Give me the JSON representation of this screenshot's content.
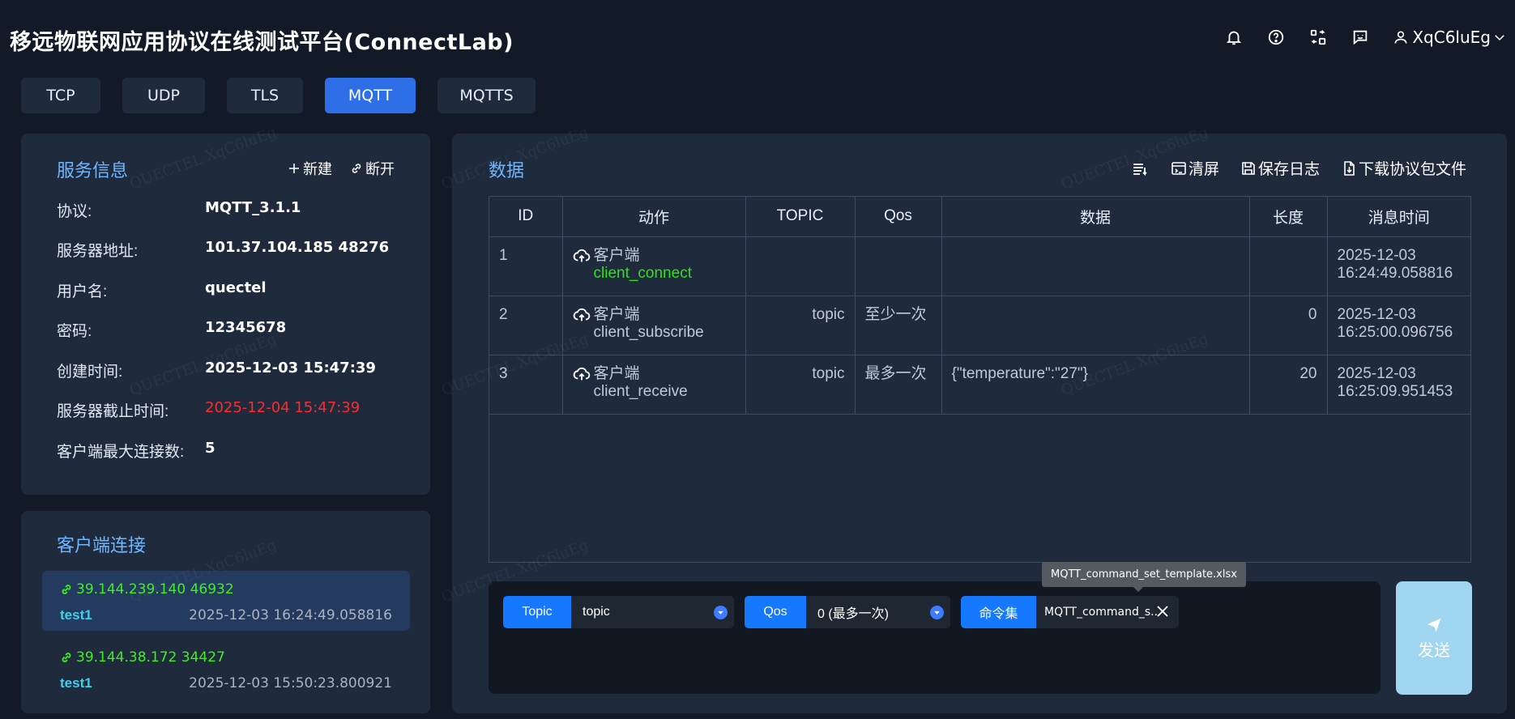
{
  "app": {
    "title": "移远物联网应用协议在线测试平台(ConnectLab)"
  },
  "header": {
    "icons": [
      "bell-icon",
      "help-icon",
      "transfer-icon",
      "feedback-icon"
    ],
    "user": {
      "name": "XqC6luEg",
      "icon": "user-icon"
    }
  },
  "protocol_tabs": [
    {
      "label": "TCP",
      "active": false
    },
    {
      "label": "UDP",
      "active": false
    },
    {
      "label": "TLS",
      "active": false
    },
    {
      "label": "MQTT",
      "active": true
    },
    {
      "label": "MQTTS",
      "active": false
    }
  ],
  "service": {
    "title": "服务信息",
    "new_label": "新建",
    "disconnect_label": "断开",
    "rows": [
      {
        "label": "协议:",
        "value": "MQTT_3.1.1"
      },
      {
        "label": "服务器地址:",
        "value": "101.37.104.185 48276"
      },
      {
        "label": "用户名:",
        "value": "quectel"
      },
      {
        "label": "密码:",
        "value": "12345678"
      },
      {
        "label": "创建时间:",
        "value": "2025-12-03 15:47:39"
      },
      {
        "label": "服务器截止时间:",
        "value": "2025-12-04 15:47:39",
        "highlight": "red"
      },
      {
        "label": "客户端最大连接数:",
        "value": "5"
      }
    ]
  },
  "clients": {
    "title": "客户端连接",
    "items": [
      {
        "address": "39.144.239.140 46932",
        "name": "test1",
        "time": "2025-12-03 16:24:49.058816",
        "active": true
      },
      {
        "address": "39.144.38.172 34427",
        "name": "test1",
        "time": "2025-12-03 15:50:23.800921",
        "active": false
      }
    ]
  },
  "data_panel": {
    "title": "数据",
    "actions": {
      "list_icon": "list-icon",
      "clear": "清屏",
      "save_log": "保存日志",
      "download": "下载协议包文件"
    },
    "columns": [
      "ID",
      "动作",
      "TOPIC",
      "Qos",
      "数据",
      "长度",
      "消息时间"
    ],
    "rows": [
      {
        "id": "1",
        "action_type": "客户端",
        "action": "client_connect",
        "action_color": "green",
        "topic": "",
        "qos": "",
        "data": "",
        "length": "",
        "time_date": "2025-12-03",
        "time_clock": "16:24:49.058816"
      },
      {
        "id": "2",
        "action_type": "客户端",
        "action": "client_subscribe",
        "action_color": "",
        "topic": "topic",
        "qos": "至少一次",
        "data": "",
        "length": "0",
        "time_date": "2025-12-03",
        "time_clock": "16:25:00.096756"
      },
      {
        "id": "3",
        "action_type": "客户端",
        "action": "client_receive",
        "action_color": "",
        "topic": "topic",
        "qos": "最多一次",
        "data": "{\"temperature\":\"27\"}",
        "length": "20",
        "time_date": "2025-12-03",
        "time_clock": "16:25:09.951453"
      }
    ]
  },
  "send": {
    "topic_label": "Topic",
    "topic_value": "topic",
    "qos_label": "Qos",
    "qos_value": "0 (最多一次)",
    "cmdset_label": "命令集",
    "cmdset_value": "MQTT_command_s...",
    "cmdset_tooltip": "MQTT_command_set_template.xlsx",
    "send_label": "发送"
  },
  "watermark_text": "QUECTEL XqC6luEg"
}
